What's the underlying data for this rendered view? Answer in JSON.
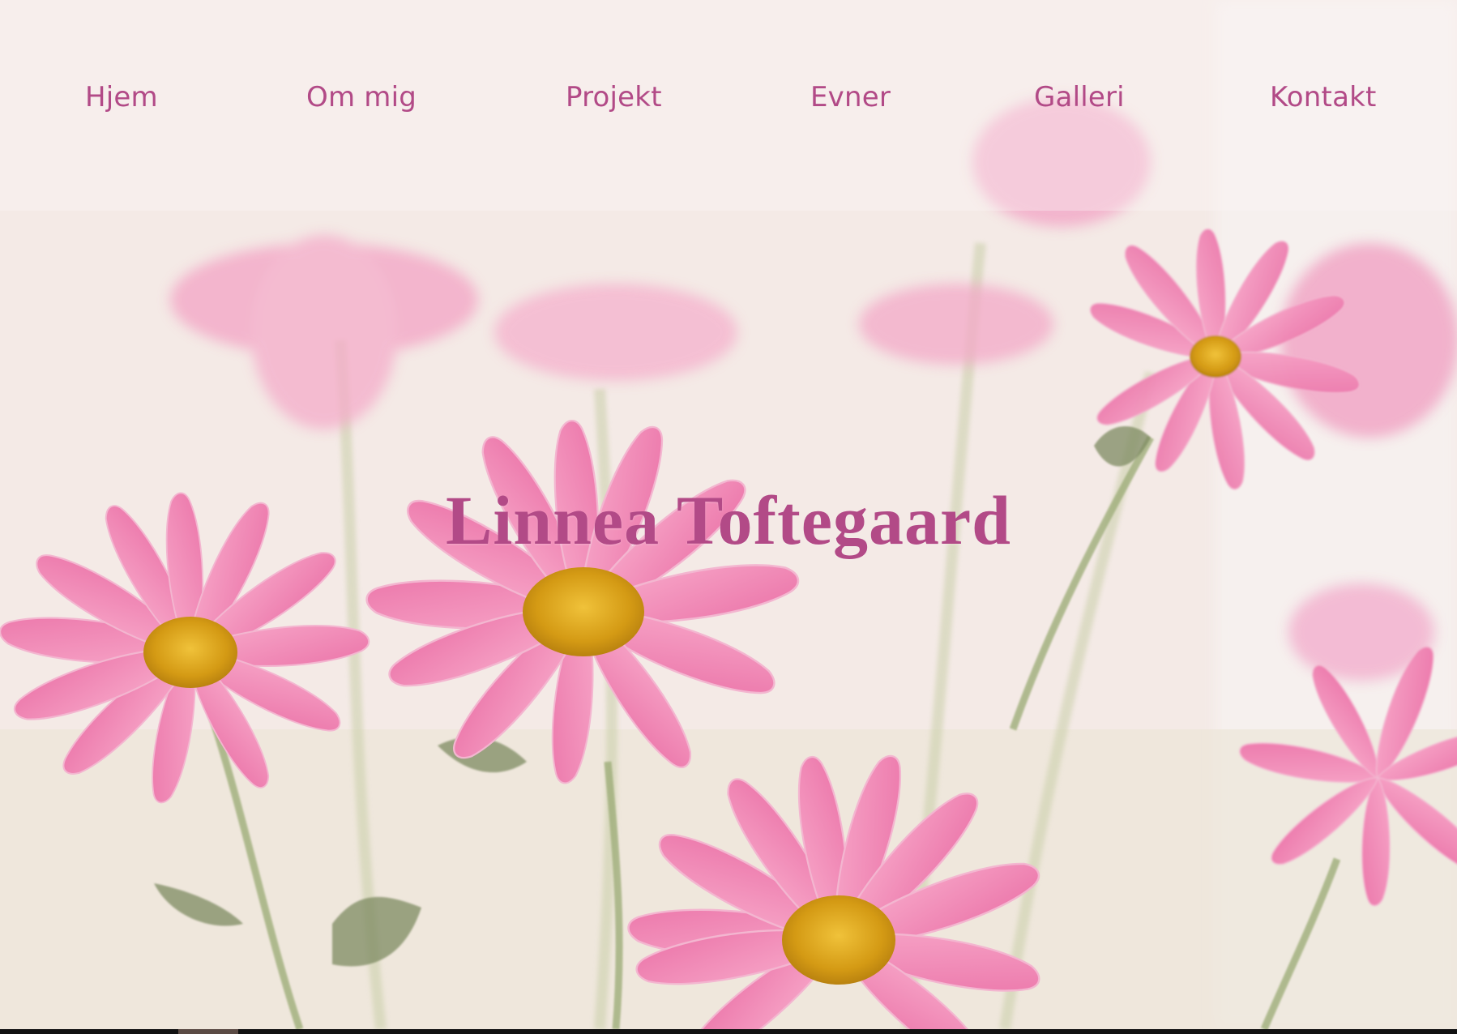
{
  "nav": {
    "items": [
      {
        "label": "Hjem"
      },
      {
        "label": "Om mig"
      },
      {
        "label": "Projekt"
      },
      {
        "label": "Evner"
      },
      {
        "label": "Galleri"
      },
      {
        "label": "Kontakt"
      }
    ]
  },
  "hero": {
    "title": "Linnea Toftegaard",
    "background_image": "pink-daisy-flowers"
  },
  "colors": {
    "accent": "#b24a87",
    "petal": "#f08ab8",
    "center": "#d9a21c"
  }
}
